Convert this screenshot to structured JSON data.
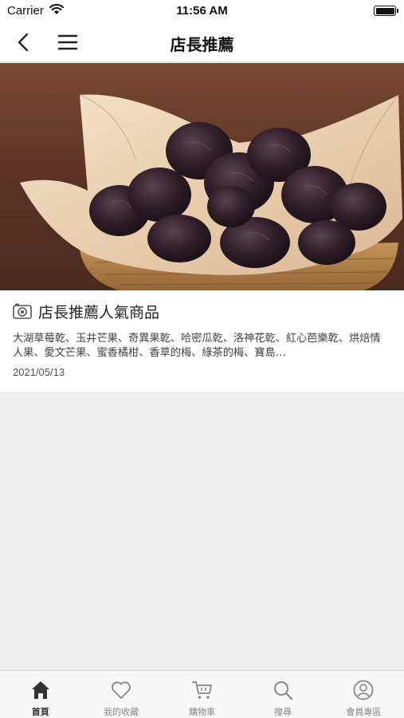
{
  "status_bar": {
    "carrier": "Carrier",
    "time": "11:56 AM"
  },
  "nav": {
    "title": "店長推薦"
  },
  "article": {
    "image_subject": "dried prunes in a woven basket",
    "title": "店長推薦人氣商品",
    "description": "大湖草莓乾、玉井芒果、奇異果乾、哈密瓜乾、洛神花乾、紅心芭樂乾、烘焙情人果、愛文芒果、蜜香橘柑、香草的梅、綠茶的梅、寶島…",
    "date": "2021/05/13"
  },
  "tabs": [
    {
      "label": "首頁",
      "icon": "home-icon",
      "active": true
    },
    {
      "label": "我的收藏",
      "icon": "heart-icon",
      "active": false
    },
    {
      "label": "購物車",
      "icon": "cart-icon",
      "active": false
    },
    {
      "label": "搜尋",
      "icon": "search-icon",
      "active": false
    },
    {
      "label": "會員專區",
      "icon": "user-icon",
      "active": false
    }
  ],
  "colors": {
    "background": "#efefef",
    "tab_active": "#333333",
    "tab_inactive": "#888888"
  }
}
